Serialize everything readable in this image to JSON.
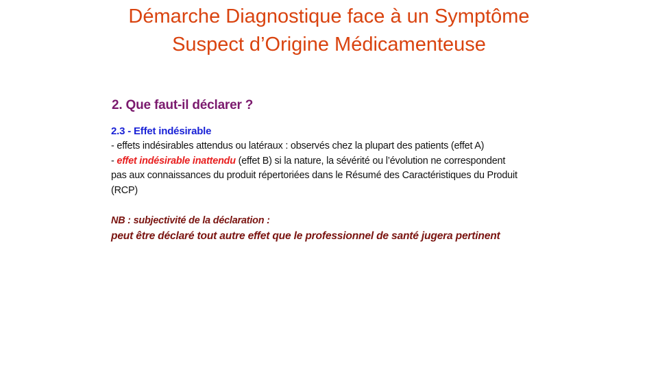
{
  "slide": {
    "title_line1": "Démarche Diagnostique face à un Symptôme",
    "title_line2": "Suspect d’Origine Médicamenteuse",
    "section_heading": "2. Que faut-il déclarer ?",
    "subsection_heading": "2.3 - Effet indésirable",
    "item1_text": "- effets  indésirables  attendus  ou latéraux  : observés chez la plupart  des patients  (effet A)",
    "item2_prefix": "- ",
    "item2_emphasis": "effet indésirable  inattendu",
    "item2_rest_line1": " (effet  B) si la nature,  la sévérité  ou l’évolution  ne correspondent",
    "item2_line2": "pas aux connaissances  du produit répertoriées  dans le Résumé des Caractéristiques  du Produit",
    "item2_line3": "(RCP)",
    "nb_title": "NB : subjectivité de la déclaration  :",
    "nb_text": "peut être déclaré tout autre effet que le professionnel de santé jugera pertinent"
  },
  "colors": {
    "title": "#d9430f",
    "section_heading": "#7b1a6e",
    "subsection_heading": "#1a22d6",
    "emphasis_red": "#e81e1e",
    "nb_dark_red": "#7a1410"
  }
}
